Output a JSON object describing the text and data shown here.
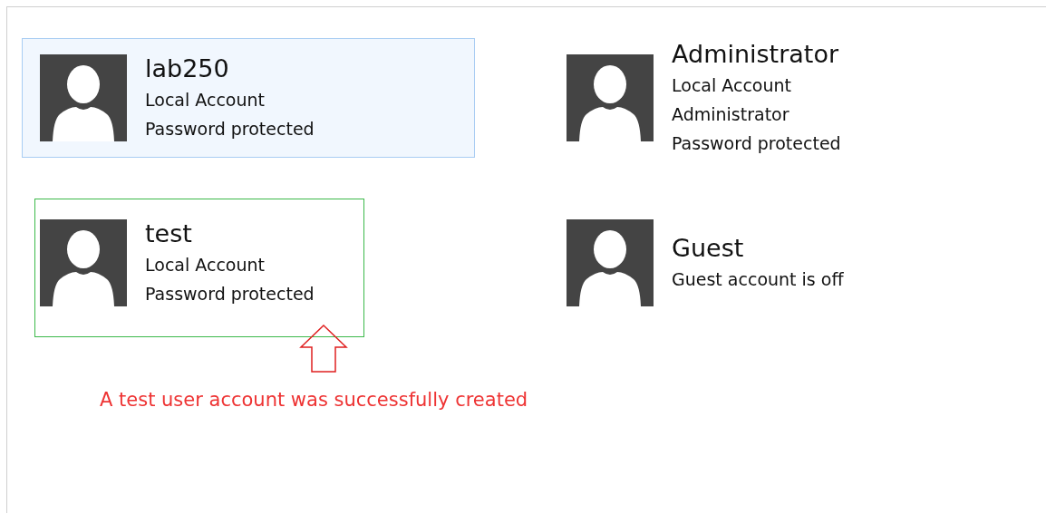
{
  "accounts": [
    {
      "name": "lab250",
      "details": [
        "Local Account",
        "Password protected"
      ],
      "selected": true,
      "outlined": false
    },
    {
      "name": "Administrator",
      "details": [
        "Local Account",
        "Administrator",
        "Password protected"
      ],
      "selected": false,
      "outlined": false
    },
    {
      "name": "test",
      "details": [
        "Local Account",
        "Password protected"
      ],
      "selected": false,
      "outlined": true
    },
    {
      "name": "Guest",
      "details": [
        "Guest account is off"
      ],
      "selected": false,
      "outlined": false
    }
  ],
  "note": "A test user account was successfully created"
}
